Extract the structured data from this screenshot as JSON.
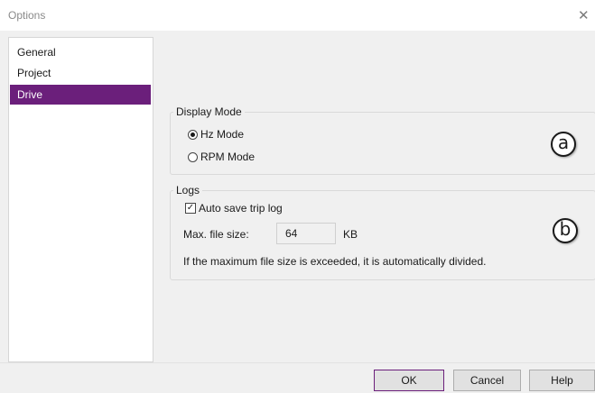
{
  "window": {
    "title": "Options",
    "close_glyph": "✕"
  },
  "nav": {
    "items": [
      {
        "label": "General",
        "selected": false
      },
      {
        "label": "Project",
        "selected": false
      },
      {
        "label": "Drive",
        "selected": true
      }
    ]
  },
  "display_mode": {
    "legend": "Display Mode",
    "options": [
      {
        "label": "Hz Mode",
        "checked": true
      },
      {
        "label": "RPM Mode",
        "checked": false
      }
    ]
  },
  "logs": {
    "legend": "Logs",
    "auto_save_label": "Auto save trip log",
    "auto_save_checked": true,
    "max_size_label": "Max. file size:",
    "max_size_value": "64",
    "max_size_unit": "KB",
    "note": "If the maximum file size is exceeded, it is automatically divided."
  },
  "annotations": {
    "a": "a",
    "b": "b"
  },
  "footer": {
    "ok_label": "OK",
    "cancel_label": "Cancel",
    "help_label": "Help"
  },
  "colors": {
    "accent": "#6b1f7b"
  }
}
